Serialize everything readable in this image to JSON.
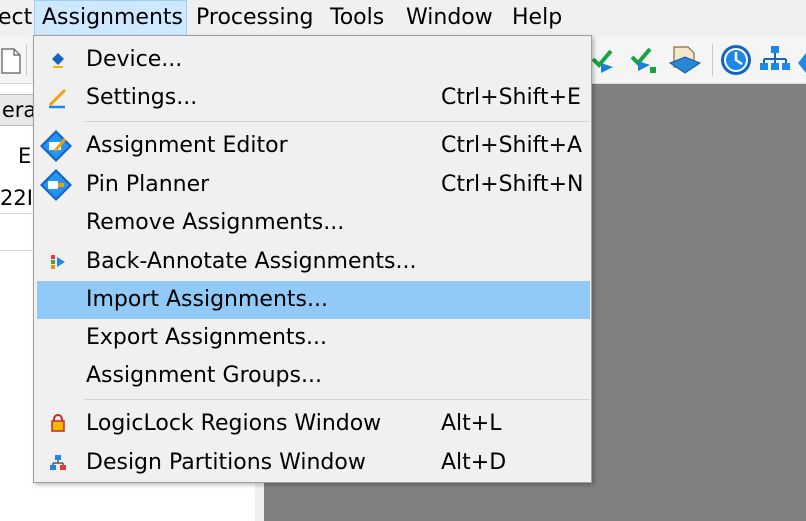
{
  "menubar": {
    "items": [
      {
        "label": "ect"
      },
      {
        "label": "Assignments"
      },
      {
        "label": "Processing"
      },
      {
        "label": "Tools"
      },
      {
        "label": "Window"
      },
      {
        "label": "Help"
      }
    ]
  },
  "left_panel": {
    "tab_fragment": "iera",
    "column_fragment": "E",
    "cell_fragment": "22I"
  },
  "assignments_menu": {
    "items": [
      {
        "label": "Device...",
        "shortcut": "",
        "icon": "device-icon"
      },
      {
        "label": "Settings...",
        "shortcut": "Ctrl+Shift+E",
        "icon": "settings-icon"
      },
      {
        "label": "Assignment Editor",
        "shortcut": "Ctrl+Shift+A",
        "icon": "assignment-editor-icon"
      },
      {
        "label": "Pin Planner",
        "shortcut": "Ctrl+Shift+N",
        "icon": "pin-planner-icon"
      },
      {
        "label": "Remove Assignments...",
        "shortcut": "",
        "icon": ""
      },
      {
        "label": "Back-Annotate Assignments...",
        "shortcut": "",
        "icon": "back-annotate-icon"
      },
      {
        "label": "Import Assignments...",
        "shortcut": "",
        "icon": "",
        "highlighted": true
      },
      {
        "label": "Export Assignments...",
        "shortcut": "",
        "icon": ""
      },
      {
        "label": "Assignment Groups...",
        "shortcut": "",
        "icon": ""
      },
      {
        "label": "LogicLock Regions Window",
        "shortcut": "Alt+L",
        "icon": "logiclock-icon"
      },
      {
        "label": "Design Partitions Window",
        "shortcut": "Alt+D",
        "icon": "design-partitions-icon"
      }
    ]
  },
  "colors": {
    "menu_bg": "#f0f0f0",
    "highlight": "#91c9f7",
    "workspace": "#808080",
    "active_menu": "#cde8ff"
  }
}
